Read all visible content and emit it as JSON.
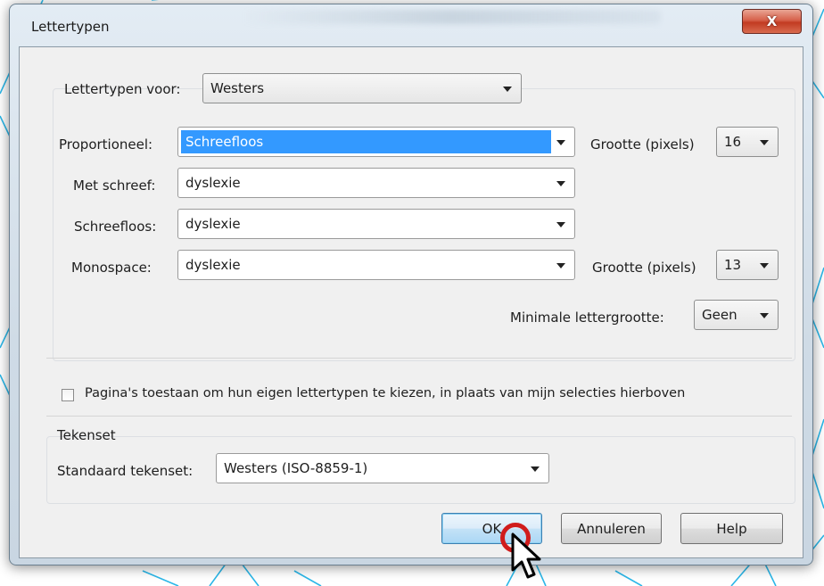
{
  "window": {
    "title": "Lettertypen",
    "close_label": "X"
  },
  "fonts_for": {
    "label": "Lettertypen voor:",
    "value": "Westers"
  },
  "rows": [
    {
      "label": "Proportioneel:",
      "value": "Schreefloos",
      "selected": true
    },
    {
      "label": "Met schreef:",
      "value": "dyslexie"
    },
    {
      "label": "Schreefloos:",
      "value": "dyslexie"
    },
    {
      "label": "Monospace:",
      "value": "dyslexie"
    }
  ],
  "size_proportional": {
    "label": "Grootte (pixels)",
    "value": "16"
  },
  "size_monospace": {
    "label": "Grootte (pixels)",
    "value": "13"
  },
  "min_size": {
    "label": "Minimale lettergrootte:",
    "value": "Geen"
  },
  "allow_pages": {
    "label": "Pagina's toestaan om hun eigen lettertypen te kiezen, in plaats van mijn selecties hierboven",
    "checked": false
  },
  "charset": {
    "heading": "Tekenset",
    "label": "Standaard tekenset:",
    "value": "Westers (ISO-8859-1)"
  },
  "buttons": {
    "ok": "OK",
    "cancel": "Annuleren",
    "help": "Help"
  },
  "colors": {
    "selection": "#3399ff",
    "cursor_highlight": "#d01c1c",
    "background_lines": "#2bb7e8"
  },
  "icons": [
    "close-icon",
    "dropdown-arrow-icon",
    "mouse-cursor-icon"
  ]
}
